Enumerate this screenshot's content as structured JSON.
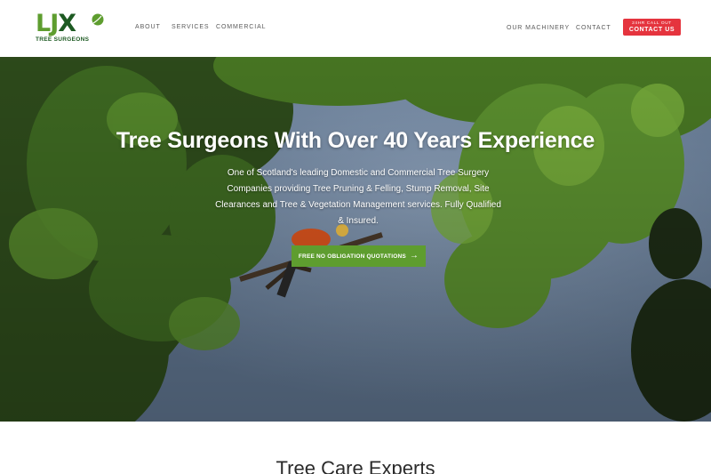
{
  "brand": {
    "logo_text": "LJX",
    "logo_subtitle": "TREE SURGEONS",
    "colors": {
      "primary_green": "#5e9d2f",
      "dark_green": "#1d5a22",
      "accent_red": "#e5343e"
    }
  },
  "nav": {
    "left": [
      "ABOUT",
      "SERVICES",
      "COMMERCIAL"
    ],
    "right": [
      "OUR MACHINERY",
      "CONTACT"
    ],
    "cta": {
      "line1": "24HR CALL OUT",
      "line2": "CONTACT US"
    }
  },
  "hero": {
    "title": "Tree Surgeons With Over 40 Years Experience",
    "lines": [
      "One of Scotland's leading Domestic and Commercial Tree Surgery",
      "Companies providing Tree Pruning & Felling, Stump Removal, Site",
      "Clearances and Tree & Vegetation Management services. Fully Qualified",
      "& Insured."
    ],
    "button_label": "FREE NO OBLIGATION QUOTATIONS",
    "button_icon": "arrow-right-icon"
  },
  "section": {
    "title": "Tree Care Experts"
  }
}
